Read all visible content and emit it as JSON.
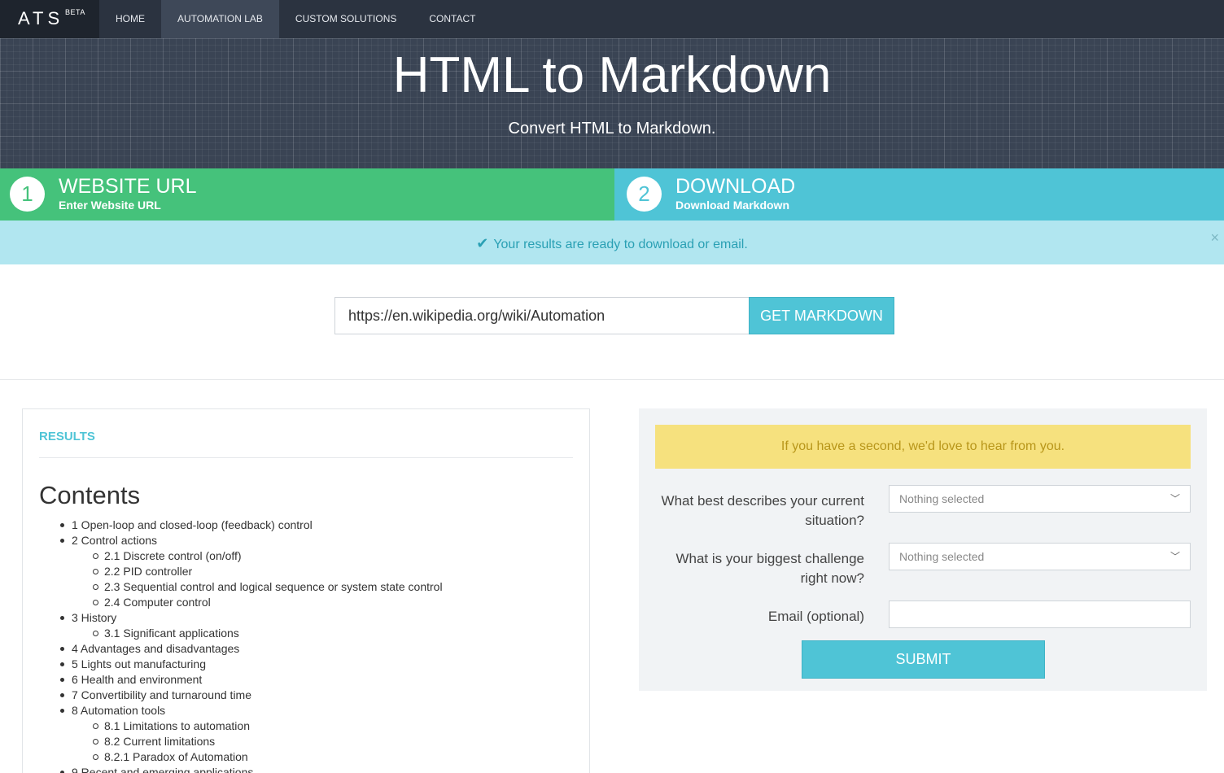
{
  "nav": {
    "brand": "ATS",
    "beta": "BETA",
    "items": [
      "HOME",
      "AUTOMATION LAB",
      "CUSTOM SOLUTIONS",
      "CONTACT"
    ]
  },
  "hero": {
    "title": "HTML to Markdown",
    "subtitle": "Convert HTML to Markdown."
  },
  "steps": [
    {
      "num": "1",
      "title": "WEBSITE URL",
      "desc": "Enter Website URL"
    },
    {
      "num": "2",
      "title": "DOWNLOAD",
      "desc": "Download Markdown"
    }
  ],
  "alert": {
    "message": "Your results are ready to download or email.",
    "close": "×"
  },
  "url_form": {
    "value": "https://en.wikipedia.org/wiki/Automation",
    "button": "GET MARKDOWN"
  },
  "results": {
    "label": "RESULTS",
    "heading": "Contents",
    "toc": [
      "1 Open-loop and closed-loop (feedback) control",
      "2 Control actions",
      "2.1 Discrete control (on/off)",
      "2.2 PID controller",
      "2.3 Sequential control and logical sequence or system state control",
      "2.4 Computer control",
      "3 History",
      "3.1 Significant applications",
      "4 Advantages and disadvantages",
      "5 Lights out manufacturing",
      "6 Health and environment",
      "7 Convertibility and turnaround time",
      "8 Automation tools",
      "8.1 Limitations to automation",
      "8.2 Current limitations",
      "8.2.1 Paradox of Automation",
      "9 Recent and emerging applications"
    ]
  },
  "feedback": {
    "notice": "If you have a second, we'd love to hear from you.",
    "q1": "What best describes your current situation?",
    "q1_value": "Nothing selected",
    "q2": "What is your biggest challenge right now?",
    "q2_value": "Nothing selected",
    "email_label": "Email (optional)",
    "submit": "SUBMIT"
  },
  "colors": {
    "nav": "#2b3340",
    "step1": "#45c27b",
    "step2": "#4fc4d6",
    "alert": "#b1e6f0",
    "notice": "#f6e17e"
  }
}
